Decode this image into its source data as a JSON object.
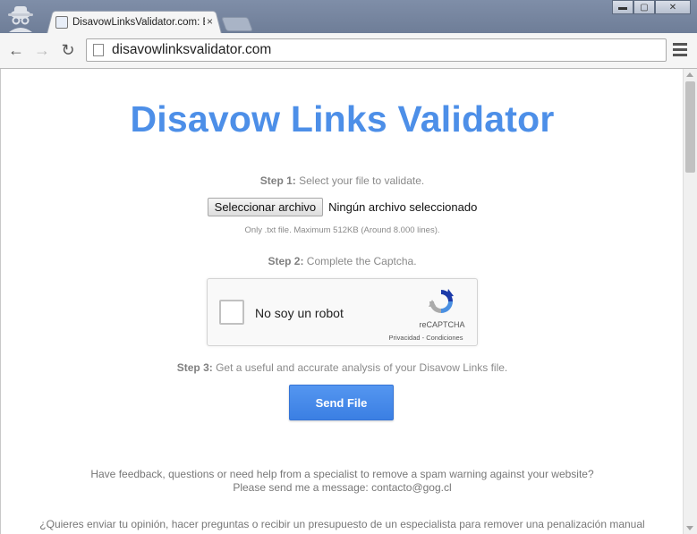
{
  "browser": {
    "tab_title": "DisavowLinksValidator.com: E",
    "tab_close": "×",
    "url": "disavowlinksvalidator.com",
    "window_controls": {
      "minimize": "▬",
      "maximize": "▢",
      "close": "✕"
    },
    "nav": {
      "back": "←",
      "forward": "→",
      "reload": "↻"
    },
    "icons": [
      "incognito-icon",
      "favicon",
      "back-arrow-icon",
      "forward-arrow-icon",
      "reload-icon",
      "page-icon",
      "menu-icon"
    ]
  },
  "page": {
    "title": "Disavow Links Validator",
    "step1": {
      "label": "Step 1:",
      "text": " Select your file to validate."
    },
    "file_button": "Seleccionar archivo",
    "file_status": "Ningún archivo seleccionado",
    "file_hint": "Only .txt file. Maximum 512KB (Around 8.000 lines).",
    "step2": {
      "label": "Step 2:",
      "text": " Complete the Captcha."
    },
    "captcha": {
      "label": "No soy un robot",
      "brand": "reCAPTCHA",
      "links": "Privacidad - Condiciones"
    },
    "step3": {
      "label": "Step 3:",
      "text": " Get a useful and accurate analysis of your Disavow Links file."
    },
    "send_button": "Send File",
    "feedback_line1": "Have feedback, questions or need help from a specialist to remove a spam warning against your website?",
    "feedback_line2": "Please send me a message: contacto@gog.cl",
    "feedback_es": "¿Quieres enviar tu opinión, hacer preguntas o recibir un presupuesto de un especialista para remover una penalización manual"
  },
  "colors": {
    "title": "#4d8fe8",
    "send_button": "#4a8cee",
    "chrome_frame": "#7585a0"
  }
}
